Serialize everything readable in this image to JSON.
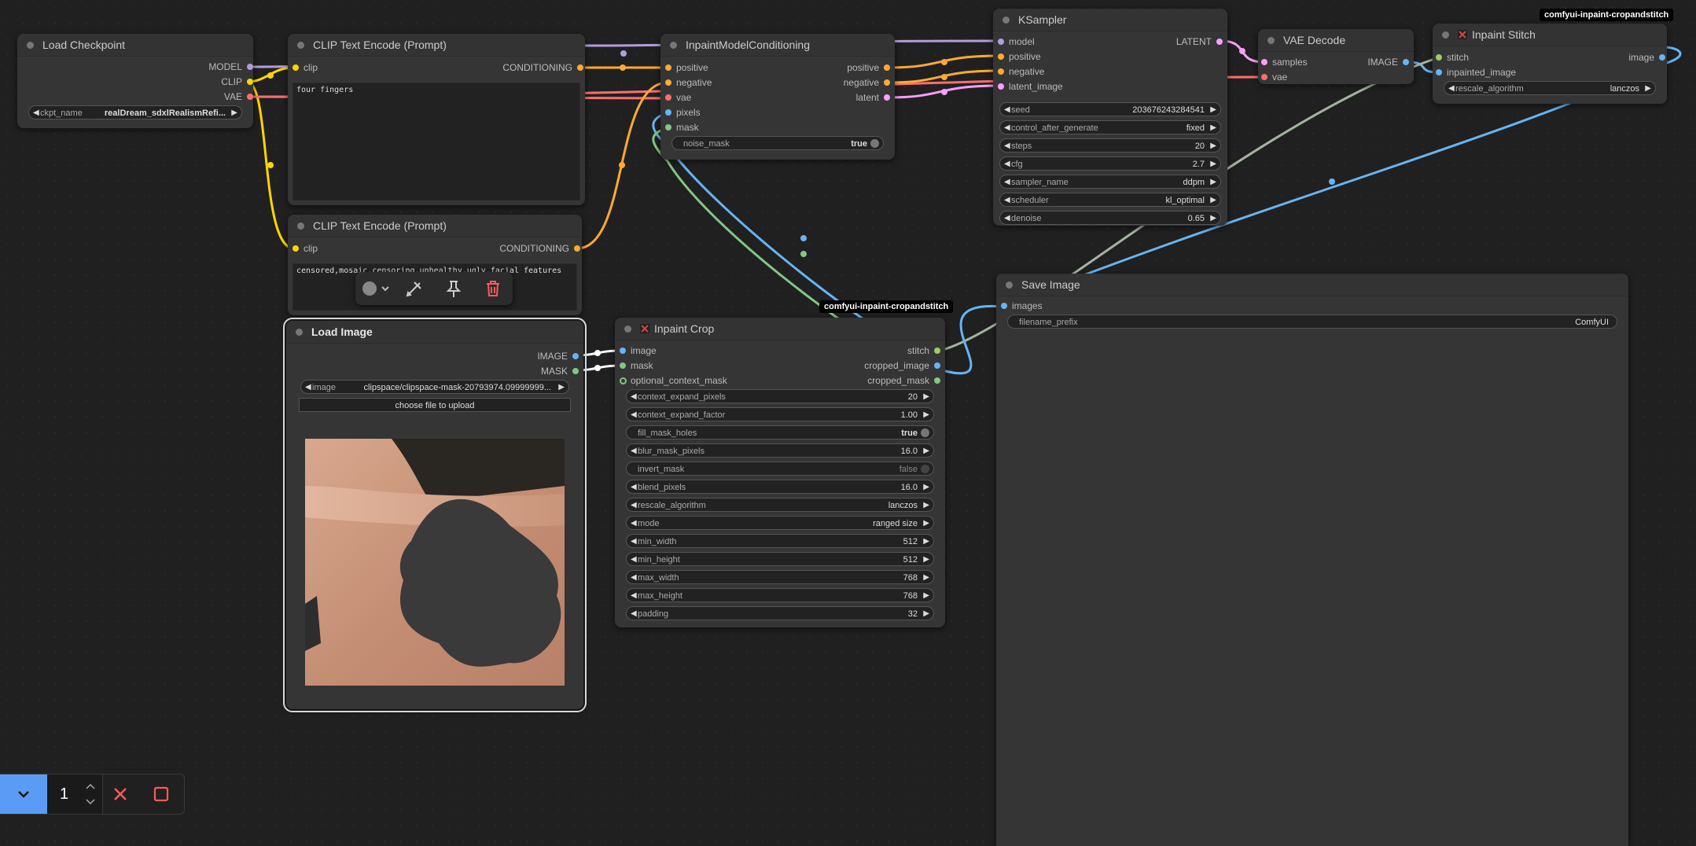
{
  "colors": {
    "model": "#b39ddb",
    "clip": "#ffd500",
    "vae": "#ff6e6e",
    "conditioning": "#ffa931",
    "latent": "#ff9cf9",
    "image": "#64b5f6",
    "mask": "#81c784",
    "stitch": "#9ccc65",
    "background": "#202020",
    "node": "#353535",
    "queue_button": "#5a9cf5"
  },
  "badges": {
    "top": "comfyui-inpaint-cropandstitch",
    "mid": "comfyui-inpaint-cropandstitch"
  },
  "load_checkpoint": {
    "title": "Load Checkpoint",
    "outputs": [
      "MODEL",
      "CLIP",
      "VAE"
    ],
    "ckpt_label": "ckpt_name",
    "ckpt_value": "realDream_sdxlRealismRefi..."
  },
  "clip_pos": {
    "title": "CLIP Text Encode (Prompt)",
    "input": "clip",
    "output": "CONDITIONING",
    "text": "four fingers"
  },
  "clip_neg": {
    "title": "CLIP Text Encode (Prompt)",
    "input": "clip",
    "output": "CONDITIONING",
    "text": "censored,mosaic,censoring,unhealthy,ugly,facial features"
  },
  "inpaint_cond": {
    "title": "InpaintModelConditioning",
    "inputs": [
      "positive",
      "negative",
      "vae",
      "pixels",
      "mask"
    ],
    "outputs": [
      "positive",
      "negative",
      "latent"
    ],
    "noise_mask_label": "noise_mask",
    "noise_mask_value": "true"
  },
  "ksampler": {
    "title": "KSampler",
    "inputs": [
      "model",
      "positive",
      "negative",
      "latent_image"
    ],
    "output": "LATENT",
    "widgets": [
      {
        "label": "seed",
        "value": "203676243284541"
      },
      {
        "label": "control_after_generate",
        "value": "fixed"
      },
      {
        "label": "steps",
        "value": "20"
      },
      {
        "label": "cfg",
        "value": "2.7"
      },
      {
        "label": "sampler_name",
        "value": "ddpm"
      },
      {
        "label": "scheduler",
        "value": "kl_optimal"
      },
      {
        "label": "denoise",
        "value": "0.65"
      }
    ]
  },
  "vae_decode": {
    "title": "VAE Decode",
    "inputs": [
      "samples",
      "vae"
    ],
    "output": "IMAGE"
  },
  "inpaint_stitch": {
    "title": "Inpaint Stitch",
    "inputs": [
      "stitch",
      "inpainted_image"
    ],
    "output": "image",
    "rescale_label": "rescale_algorithm",
    "rescale_value": "lanczos"
  },
  "save_image": {
    "title": "Save Image",
    "input": "images",
    "prefix_label": "filename_prefix",
    "prefix_value": "ComfyUI"
  },
  "load_image": {
    "title": "Load Image",
    "outputs": [
      "IMAGE",
      "MASK"
    ],
    "image_label": "image",
    "image_value": "clipspace/clipspace-mask-20793974.09999999...",
    "upload_label": "choose file to upload"
  },
  "inpaint_crop": {
    "title": "Inpaint Crop",
    "inputs": [
      "image",
      "mask",
      "optional_context_mask"
    ],
    "outputs": [
      "stitch",
      "cropped_image",
      "cropped_mask"
    ],
    "widgets": [
      {
        "label": "context_expand_pixels",
        "value": "20",
        "kind": "num"
      },
      {
        "label": "context_expand_factor",
        "value": "1.00",
        "kind": "num"
      },
      {
        "label": "fill_mask_holes",
        "value": "true",
        "kind": "toggle_on"
      },
      {
        "label": "blur_mask_pixels",
        "value": "16.0",
        "kind": "num"
      },
      {
        "label": "invert_mask",
        "value": "false",
        "kind": "toggle_off"
      },
      {
        "label": "blend_pixels",
        "value": "16.0",
        "kind": "num"
      },
      {
        "label": "rescale_algorithm",
        "value": "lanczos",
        "kind": "num"
      },
      {
        "label": "mode",
        "value": "ranged size",
        "kind": "num"
      },
      {
        "label": "min_width",
        "value": "512",
        "kind": "num"
      },
      {
        "label": "min_height",
        "value": "512",
        "kind": "num"
      },
      {
        "label": "max_width",
        "value": "768",
        "kind": "num"
      },
      {
        "label": "max_height",
        "value": "768",
        "kind": "num"
      },
      {
        "label": "padding",
        "value": "32",
        "kind": "num"
      }
    ]
  },
  "queue": {
    "batch_count": "1"
  }
}
